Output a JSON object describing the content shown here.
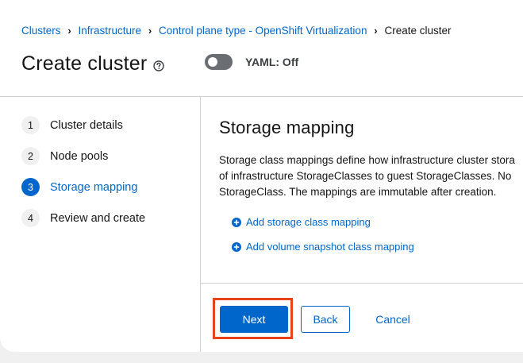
{
  "breadcrumb": {
    "items": [
      "Clusters",
      "Infrastructure",
      "Control plane type - OpenShift Virtualization"
    ],
    "current": "Create cluster"
  },
  "header": {
    "title": "Create cluster",
    "help_icon": "question-circle-icon",
    "yaml_toggle": {
      "label": "YAML: Off",
      "state": "off"
    }
  },
  "wizard": {
    "steps": [
      {
        "number": "1",
        "label": "Cluster details"
      },
      {
        "number": "2",
        "label": "Node pools"
      },
      {
        "number": "3",
        "label": "Storage mapping",
        "active": true
      },
      {
        "number": "4",
        "label": "Review and create"
      }
    ]
  },
  "main": {
    "section_title": "Storage mapping",
    "description_lines": [
      "Storage class mappings define how infrastructure cluster stora",
      "of infrastructure StorageClasses to guest StorageClasses. No",
      "StorageClass. The mappings are immutable after creation."
    ],
    "add_storage_class_mapping": "Add storage class mapping",
    "add_volume_snapshot_class_mapping": "Add volume snapshot class mapping",
    "add_icon": "plus-circle-icon"
  },
  "footer": {
    "next_label": "Next",
    "back_label": "Back",
    "cancel_label": "Cancel"
  },
  "colors": {
    "link": "#0066cc",
    "primary_button": "#0066cc",
    "highlight": "#e8431b",
    "toggle_off": "#6a6e73"
  }
}
